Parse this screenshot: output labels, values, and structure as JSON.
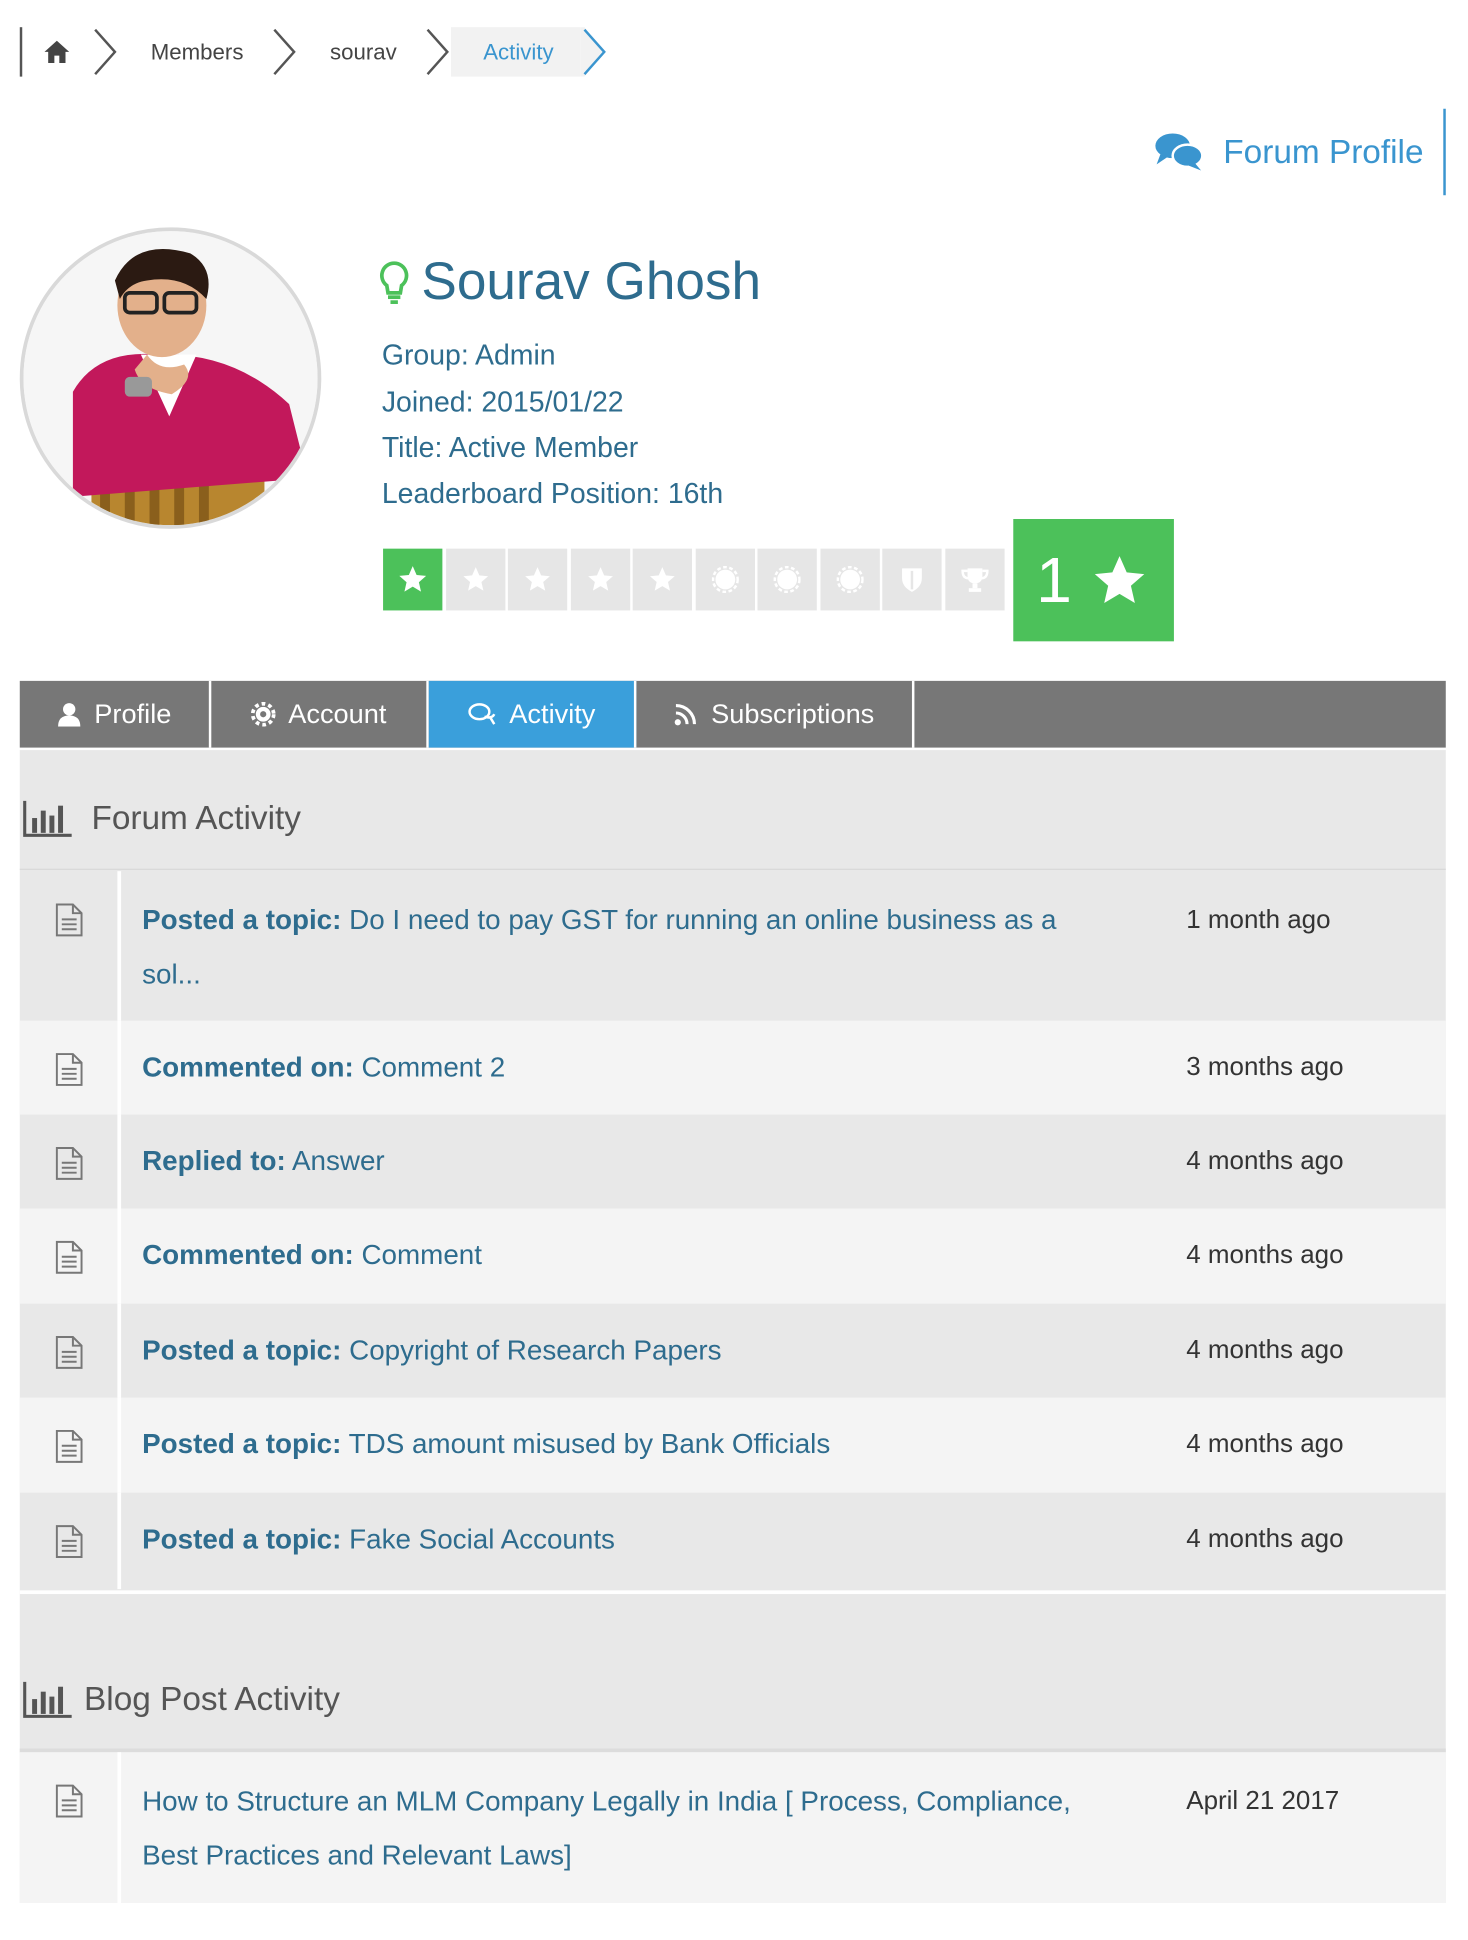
{
  "breadcrumb": {
    "items": [
      "Members",
      "sourav"
    ],
    "active": "Activity"
  },
  "forum_profile_link": "Forum Profile",
  "user": {
    "name": "Sourav Ghosh",
    "group": "Group: Admin",
    "joined": "Joined: 2015/01/22",
    "title": "Title: Active Member",
    "leaderboard": "Leaderboard Position: 16th",
    "points": "1",
    "rank_icons": [
      "star-on",
      "star",
      "star",
      "star",
      "star",
      "badge",
      "badge",
      "badge",
      "shield",
      "trophy"
    ]
  },
  "tabs": [
    {
      "label": "Profile",
      "icon": "user-icon"
    },
    {
      "label": "Account",
      "icon": "gear-icon"
    },
    {
      "label": "Activity",
      "icon": "comments-icon",
      "active": true
    },
    {
      "label": "Subscriptions",
      "icon": "rss-icon"
    }
  ],
  "forum_activity": {
    "title": "Forum Activity",
    "items": [
      {
        "type": "Posted a topic:",
        "text": "Do I need to pay GST for running an online business as a",
        "text2": "sol...",
        "time": "1 month  ago"
      },
      {
        "type": "Commented on:",
        "text": "Comment 2",
        "time": "3 months  ago"
      },
      {
        "type": "Replied to:",
        "text": "Answer",
        "time": "4 months  ago"
      },
      {
        "type": "Commented on:",
        "text": "Comment",
        "time": "4 months  ago"
      },
      {
        "type": "Posted a topic:",
        "text": "Copyright of Research Papers",
        "time": "4 months  ago"
      },
      {
        "type": "Posted a topic:",
        "text": "TDS amount misused by Bank Officials",
        "time": "4 months  ago"
      },
      {
        "type": "Posted a topic:",
        "text": "Fake Social Accounts",
        "time": "4 months  ago"
      }
    ]
  },
  "blog_activity": {
    "title": "Blog Post Activity",
    "items": [
      {
        "text": "How to Structure an MLM Company Legally in India [ Process, Compliance,",
        "text2": "Best Practices and Relevant Laws]",
        "time": "April 21 2017"
      }
    ]
  },
  "colors": {
    "accent": "#3a95cf",
    "green": "#4cc15a",
    "tab_bg": "#777777",
    "text_blue": "#2e6c8e"
  }
}
